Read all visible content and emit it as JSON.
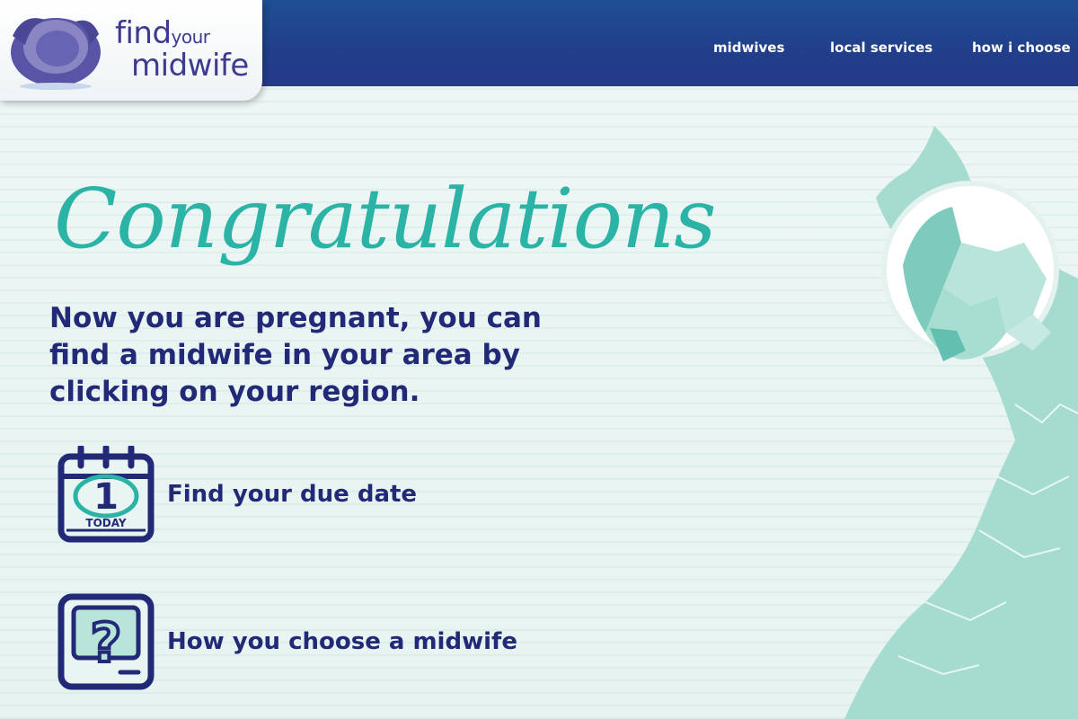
{
  "logo": {
    "line1_big": "find",
    "line1_small": "your",
    "line2": "midwife"
  },
  "nav": [
    {
      "label": "midwives"
    },
    {
      "label": "local services"
    },
    {
      "label": "how i choose"
    }
  ],
  "main": {
    "headline": "Congratulations",
    "lead": "Now you are pregnant, you can find a midwife in your area by clicking on your region."
  },
  "links": [
    {
      "label": "Find your due date",
      "icon": "calendar-icon",
      "day": "1",
      "day_caption": "TODAY"
    },
    {
      "label": "How you choose a midwife",
      "icon": "question-screen-icon",
      "glyph": "?"
    }
  ],
  "colors": {
    "header": "#233c8a",
    "brand_text": "#222a78",
    "accent_teal": "#2bb3a6",
    "map_teal": "#8fd3c4",
    "background": "#eaf5f3"
  }
}
